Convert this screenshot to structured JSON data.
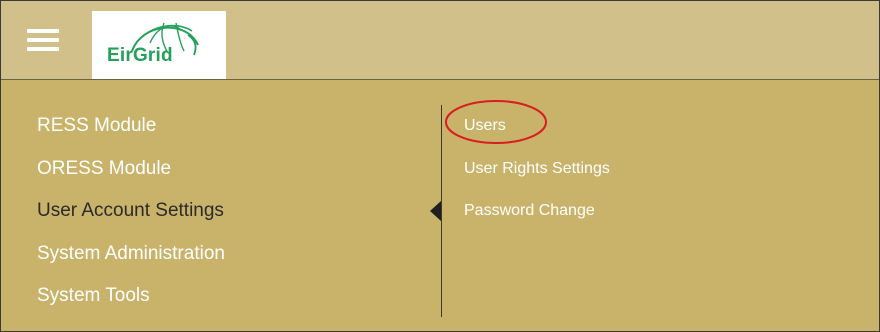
{
  "header": {
    "menu_icon": "hamburger-menu-icon",
    "logo": {
      "text": "EirGrid",
      "icon": "globe-arcs-icon",
      "brand_color": "#24a05a"
    }
  },
  "colors": {
    "background": "#c9b36b",
    "header": "#d2c08a",
    "menu_text": "#ffffff",
    "active_text": "#2a2a2a",
    "annotation": "#d81e1e"
  },
  "left_menu": {
    "items": [
      {
        "label": "RESS Module"
      },
      {
        "label": "ORESS Module"
      },
      {
        "label": "User Account Settings",
        "active": true
      },
      {
        "label": "System Administration"
      },
      {
        "label": "System Tools"
      }
    ]
  },
  "sub_menu": {
    "items": [
      {
        "label": "Users",
        "highlighted": true
      },
      {
        "label": "User Rights Settings"
      },
      {
        "label": "Password Change"
      }
    ]
  }
}
